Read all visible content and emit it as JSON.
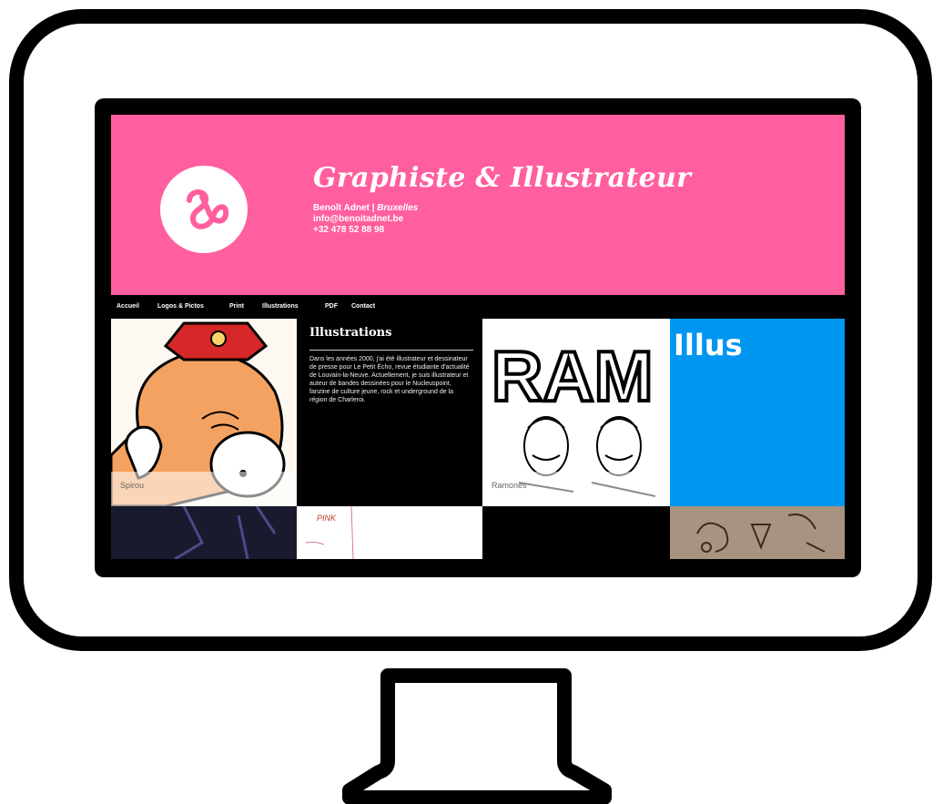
{
  "site": {
    "title": "Graphiste & Illustrateur",
    "name": "Benoît Adnet",
    "separator": " | ",
    "city": "Bruxelles",
    "email": "info@benoitadnet.be",
    "phone": "+32 478 52 88 98"
  },
  "nav": {
    "items": [
      "Accueil",
      "Logos & Pictos",
      "Print",
      "Illustrations",
      "PDF",
      "Contact"
    ]
  },
  "tiles": {
    "spirou_caption": "Spirou",
    "ramones_caption": "Ramones",
    "ramones_art_text": "RAM",
    "bottom_art_text": "PINK",
    "blue_label": "Illus"
  },
  "panel": {
    "heading": "Illustrations",
    "body": "Dans les années 2000, j'ai été illustrateur et dessinateur de presse pour Le Petit Écho, revue étudiante d'actualité de Louvain-la-Neuve. Actuellement, je suis illustrateur et auteur de bandes dessinées pour le Nucleuspoint, fanzine de culture jeune, rock et underground de la région de Charleroi."
  },
  "colors": {
    "header_bg": "#ff5f9e",
    "blue_tile": "#0096f0",
    "frame": "#000000"
  }
}
